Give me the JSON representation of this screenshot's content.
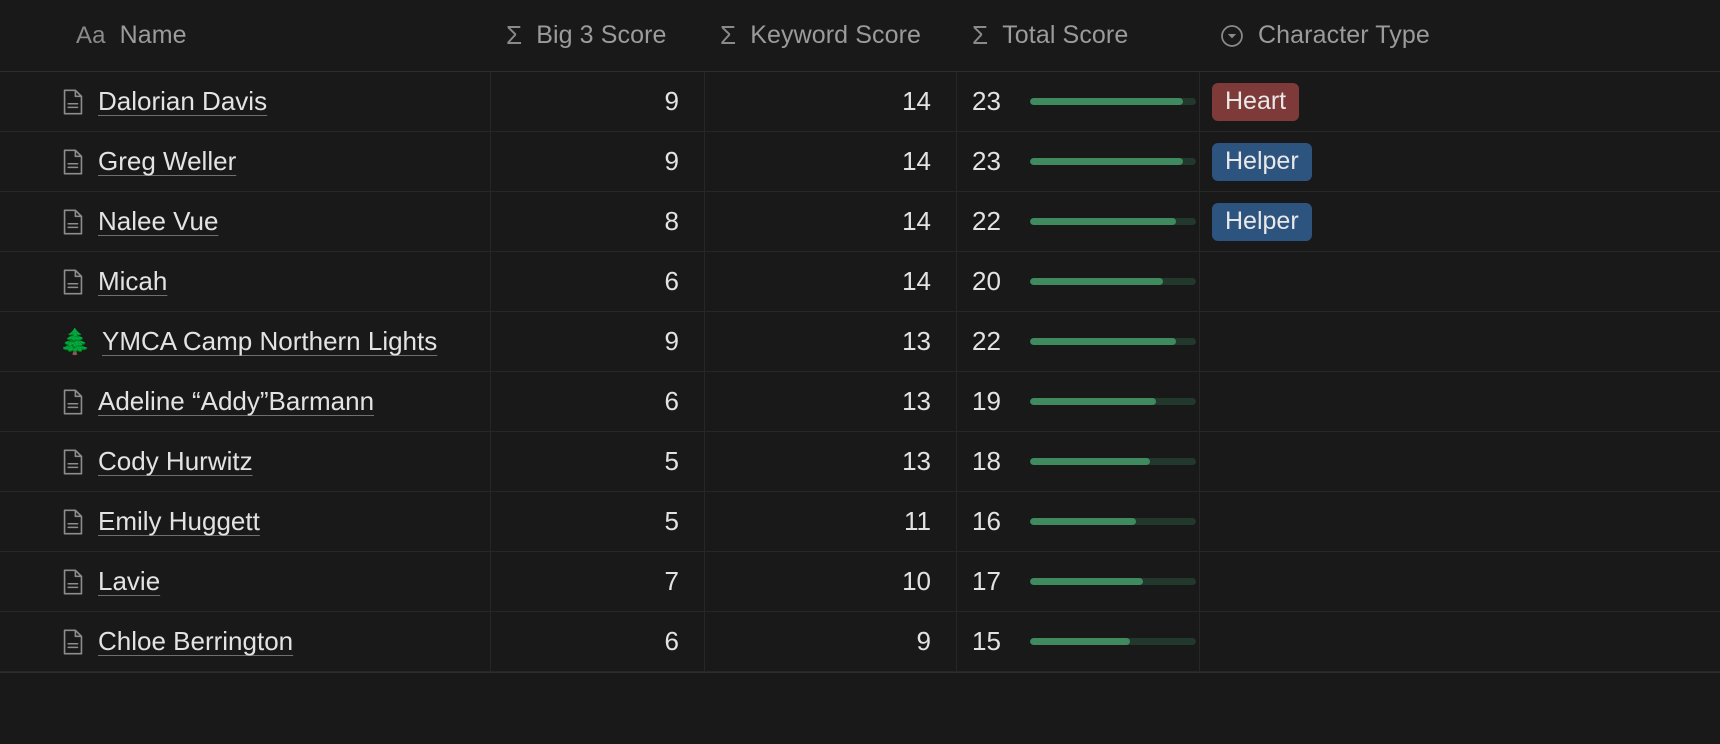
{
  "table": {
    "columns": [
      {
        "key": "name",
        "label": "Name",
        "icon": "title-icon",
        "icon_glyph": "Aa",
        "align": "left"
      },
      {
        "key": "big3",
        "label": "Big 3 Score",
        "icon": "formula-sum-icon",
        "icon_glyph": "Σ",
        "align": "right"
      },
      {
        "key": "keyword",
        "label": "Keyword Score",
        "icon": "formula-sum-icon",
        "icon_glyph": "Σ",
        "align": "right"
      },
      {
        "key": "total",
        "label": "Total Score",
        "icon": "formula-sum-icon",
        "icon_glyph": "Σ",
        "align": "right"
      },
      {
        "key": "type",
        "label": "Character Type",
        "icon": "select-chevron-down-icon",
        "icon_glyph": "▼",
        "align": "left"
      }
    ],
    "bar_max": 25,
    "rows": [
      {
        "icon": "page-icon",
        "emoji": "",
        "name": "Dalorian Davis",
        "big3": 9,
        "keyword": 14,
        "total": 23,
        "type": "Heart",
        "type_color": "#7d3a38"
      },
      {
        "icon": "page-icon",
        "emoji": "",
        "name": "Greg Weller",
        "big3": 9,
        "keyword": 14,
        "total": 23,
        "type": "Helper",
        "type_color": "#2d537f"
      },
      {
        "icon": "page-icon",
        "emoji": "",
        "name": "Nalee Vue",
        "big3": 8,
        "keyword": 14,
        "total": 22,
        "type": "Helper",
        "type_color": "#2d537f"
      },
      {
        "icon": "page-icon",
        "emoji": "",
        "name": "Micah ",
        "big3": 6,
        "keyword": 14,
        "total": 20,
        "type": "",
        "type_color": ""
      },
      {
        "icon": "emoji",
        "emoji": "🌲",
        "name": "YMCA Camp Northern Lights",
        "big3": 9,
        "keyword": 13,
        "total": 22,
        "type": "",
        "type_color": ""
      },
      {
        "icon": "page-icon",
        "emoji": "",
        "name": "Adeline “Addy”Barmann",
        "big3": 6,
        "keyword": 13,
        "total": 19,
        "type": "",
        "type_color": ""
      },
      {
        "icon": "page-icon",
        "emoji": "",
        "name": "Cody Hurwitz",
        "big3": 5,
        "keyword": 13,
        "total": 18,
        "type": "",
        "type_color": ""
      },
      {
        "icon": "page-icon",
        "emoji": "",
        "name": "Emily Huggett",
        "big3": 5,
        "keyword": 11,
        "total": 16,
        "type": "",
        "type_color": ""
      },
      {
        "icon": "page-icon",
        "emoji": "",
        "name": "Lavie",
        "big3": 7,
        "keyword": 10,
        "total": 17,
        "type": "",
        "type_color": ""
      },
      {
        "icon": "page-icon",
        "emoji": "",
        "name": "Chloe Berrington",
        "big3": 6,
        "keyword": 9,
        "total": 15,
        "type": "",
        "type_color": ""
      }
    ]
  }
}
